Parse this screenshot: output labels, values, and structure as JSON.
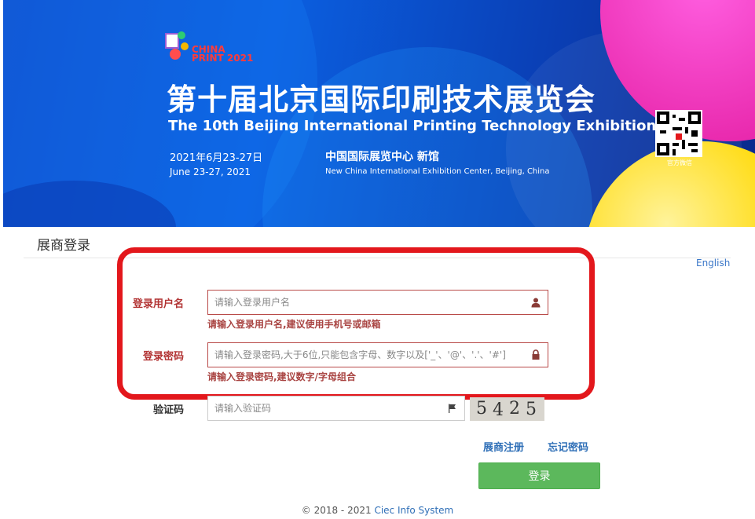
{
  "banner": {
    "logo_text_line1": "CHINA",
    "logo_text_line2": "PRINT 2021",
    "title_cn": "第十届北京国际印刷技术展览会",
    "title_en": "The 10th Beijing International Printing Technology Exhibition",
    "date_cn": "2021年6月23-27日",
    "date_en": "June 23-27, 2021",
    "venue_cn": "中国国际展览中心  新馆",
    "venue_en": "New China International Exhibition Center, Beijing, China",
    "qr_caption": "官方微信"
  },
  "page": {
    "section_title": "展商登录",
    "lang_link": "English"
  },
  "form": {
    "username": {
      "label": "登录用户名",
      "placeholder": "请输入登录用户名",
      "help": "请输入登录用户名,建议使用手机号或邮箱"
    },
    "password": {
      "label": "登录密码",
      "placeholder": "请输入登录密码,大于6位,只能包含字母、数字以及['_'、'@'、'.'、'#']",
      "help": "请输入登录密码,建议数字/字母组合"
    },
    "captcha": {
      "label": "验证码",
      "placeholder": "请输入验证码",
      "digits": [
        "5",
        "4",
        "2",
        "5"
      ]
    },
    "register_link": "展商注册",
    "forgot_link": "忘记密码",
    "login_button": "登录"
  },
  "footer": {
    "copyright": "© 2018 - 2021 ",
    "system_link": "Ciec Info System"
  },
  "colors": {
    "error": "#a94442",
    "highlight": "#e3171c",
    "primary_button": "#5cb85c",
    "link": "#2f6fb7"
  }
}
